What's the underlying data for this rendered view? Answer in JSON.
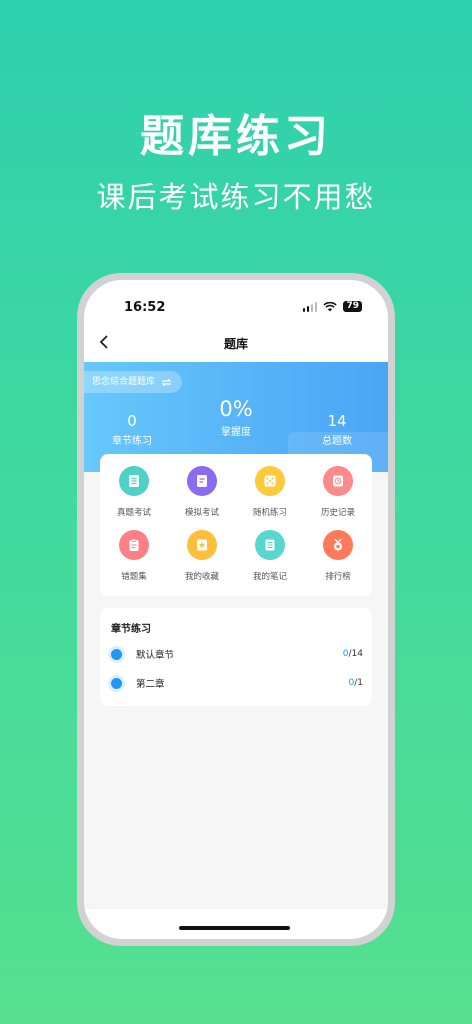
{
  "promo": {
    "title": "题库练习",
    "subtitle": "课后考试练习不用愁"
  },
  "status_bar": {
    "time": "16:52",
    "battery": "79"
  },
  "nav": {
    "back_icon": "chevron-left-icon",
    "title": "题库"
  },
  "hero": {
    "bank_name": "思念综合题题库",
    "switch_icon": "swap-icon",
    "stats": [
      {
        "value": "0",
        "label": "章节练习"
      },
      {
        "value": "0%",
        "label": "掌握度"
      },
      {
        "value": "14",
        "label": "总题数"
      }
    ]
  },
  "grid": [
    {
      "label": "真题考试",
      "icon": "list-icon",
      "color": "#4fd1c7"
    },
    {
      "label": "模拟考试",
      "icon": "document-icon",
      "color": "#8b6cf0"
    },
    {
      "label": "随机练习",
      "icon": "dice-icon",
      "color": "#ffc93c"
    },
    {
      "label": "历史记录",
      "icon": "clock-icon",
      "color": "#ff8a8a"
    },
    {
      "label": "错题集",
      "icon": "clipboard-icon",
      "color": "#ff7f87"
    },
    {
      "label": "我的收藏",
      "icon": "star-icon",
      "color": "#ffbe3b"
    },
    {
      "label": "我的笔记",
      "icon": "notebook-icon",
      "color": "#5ad6d0"
    },
    {
      "label": "排行榜",
      "icon": "medal-icon",
      "color": "#ff7a5c"
    }
  ],
  "chapters": {
    "title": "章节练习",
    "items": [
      {
        "name": "默认章节",
        "done": "0",
        "total": "/14"
      },
      {
        "name": "第二章",
        "done": "0",
        "total": "/1"
      }
    ]
  }
}
